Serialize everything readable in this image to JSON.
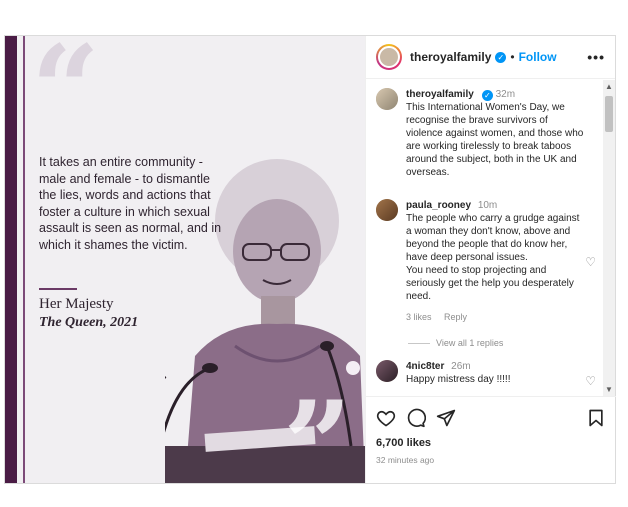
{
  "post": {
    "username": "theroyalfamily",
    "follow_label": "Follow",
    "more_label": "•••",
    "image": {
      "quote_text": "It takes an entire community - male and female - to dismantle the lies, words and actions that foster a culture in which sexual assault is seen as normal, and in which it shames the victim.",
      "attribution_name": "Her Majesty",
      "attribution_title": "The Queen, 2021"
    },
    "caption": {
      "username": "theroyalfamily",
      "time": "32m",
      "text": "This International Women's Day, we recognise the brave survivors of violence against women, and those who are working tirelessly to break taboos around the subject, both in the UK and overseas."
    },
    "comments": [
      {
        "username": "paula_rooney",
        "time": "10m",
        "text": "The people who carry a grudge against a woman they don't know, above and beyond the people that do know her, have deep personal issues.\nYou need to stop projecting and seriously get the help you desperately need.",
        "likes": "3 likes",
        "reply_label": "Reply",
        "view_replies": "View all 1 replies"
      },
      {
        "username": "4nic8ter",
        "time": "26m",
        "text": "Happy mistress day !!!!!"
      }
    ],
    "likes_count": "6,700 likes",
    "posted_time": "32 minutes ago"
  },
  "colors": {
    "accent_blue": "#0095f6",
    "purple_bar": "#4a1c45",
    "text_primary": "#262626",
    "text_secondary": "#8e8e8e"
  }
}
